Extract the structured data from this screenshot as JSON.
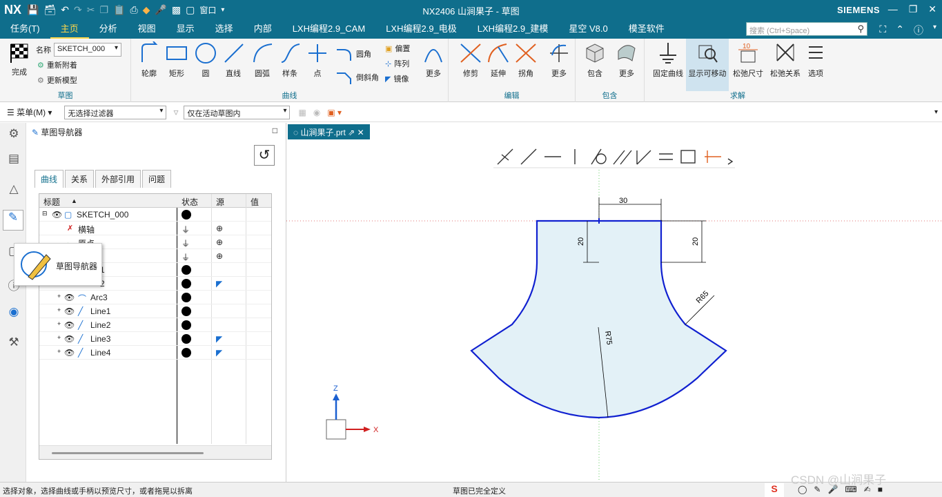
{
  "app": {
    "logo": "NX",
    "title": "NX2406 山涧果子 - 草图",
    "brand": "SIEMENS",
    "window_menu": "窗口"
  },
  "menubar": {
    "tabs": [
      "任务(T)",
      "主页",
      "分析",
      "视图",
      "显示",
      "选择",
      "内部",
      "LXH编程2.9_CAM",
      "LXH编程2.9_电极",
      "LXH编程2.9_建模",
      "星空 V8.0",
      "模圣软件"
    ],
    "search_placeholder": "搜索 (Ctrl+Space)"
  },
  "ribbon": {
    "sketch_group": {
      "title": "草图",
      "finish": "完成",
      "name_label": "名称",
      "name_value": "SKETCH_000",
      "reattach": "重新附着",
      "update_model": "更新模型"
    },
    "curve_group": {
      "title": "曲线",
      "items": [
        "轮廓",
        "矩形",
        "圆",
        "直线",
        "圆弧",
        "样条",
        "点"
      ],
      "fillet": "圆角",
      "chamfer": "倒斜角",
      "offset": "偏置",
      "pattern": "阵列",
      "mirror": "镜像",
      "more": "更多"
    },
    "edit_group": {
      "title": "编辑",
      "items": [
        "修剪",
        "延伸",
        "拐角"
      ],
      "more": "更多"
    },
    "include_group": {
      "title": "包含",
      "items": [
        "包含"
      ],
      "more": "更多"
    },
    "solve_group": {
      "title": "求解",
      "items": [
        "固定曲线",
        "显示可移动",
        "松弛尺寸",
        "松弛关系",
        "选项"
      ]
    }
  },
  "toolbar2": {
    "menu": "菜单(M)",
    "filter": "无选择过滤器",
    "scope": "仅在活动草图内"
  },
  "navigator": {
    "title": "草图导航器",
    "tabs": [
      "曲线",
      "关系",
      "外部引用",
      "问题"
    ],
    "columns": [
      "标题",
      "状态",
      "源",
      "值"
    ],
    "rows": [
      {
        "name": "SKETCH_000"
      },
      {
        "name": "横轴"
      },
      {
        "name": "原点"
      },
      {
        "name": ""
      },
      {
        "name": "1"
      },
      {
        "name": "2"
      },
      {
        "name": "Arc3"
      },
      {
        "name": "Line1"
      },
      {
        "name": "Line2"
      },
      {
        "name": "Line3"
      },
      {
        "name": "Line4"
      }
    ],
    "tooltip": "草图导航器"
  },
  "graphics": {
    "tab": "山涧果子.prt",
    "dims": {
      "top": "30",
      "left_h": "20",
      "right_h": "20",
      "arc_r": "R65",
      "bottom_r": "R75"
    },
    "axis_x": "X",
    "axis_z": "Z"
  },
  "status": {
    "left": "选择对象，选择曲线或手柄以预览尺寸，或者拖晃以拆离",
    "center": "草图已完全定义",
    "watermark": "CSDN @山涧果子"
  },
  "colors": {
    "header": "#0f6e8c",
    "sketch_blue": "#1020d0",
    "fill": "#e3f1f7"
  }
}
